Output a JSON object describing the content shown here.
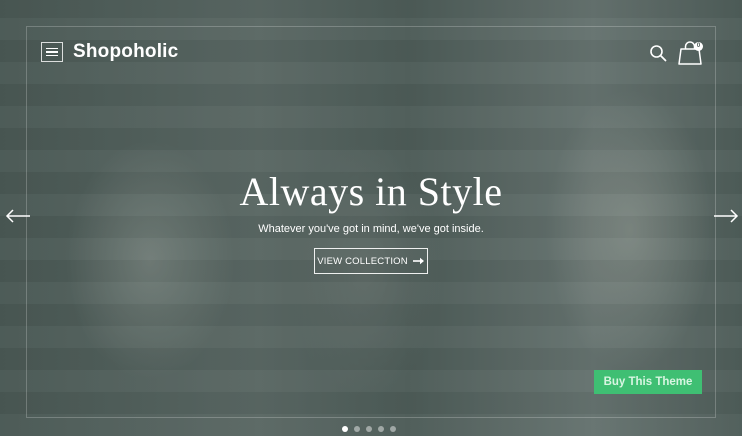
{
  "header": {
    "brand": "Shopoholic",
    "cart_count": "0"
  },
  "hero": {
    "title": "Always in Style",
    "subtitle": "Whatever you've got in mind, we've got inside.",
    "cta_label": "VIEW COLLECTION",
    "slides_total": 5,
    "active_slide": 1
  },
  "promo": {
    "buy_label": "Buy This Theme",
    "accent": "#3fbf73"
  },
  "icons": [
    "menu-icon",
    "search-icon",
    "cart-icon",
    "arrow-left-icon",
    "arrow-right-icon",
    "arrow-right-small-icon"
  ]
}
